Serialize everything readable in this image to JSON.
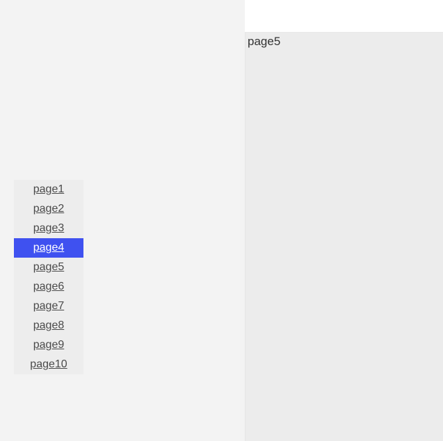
{
  "rightPanel": {
    "title": "page5"
  },
  "pageList": {
    "items": [
      {
        "label": "page1",
        "selected": false
      },
      {
        "label": "page2",
        "selected": false
      },
      {
        "label": "page3",
        "selected": false
      },
      {
        "label": "page4",
        "selected": true
      },
      {
        "label": "page5",
        "selected": false
      },
      {
        "label": "page6",
        "selected": false
      },
      {
        "label": "page7",
        "selected": false
      },
      {
        "label": "page8",
        "selected": false
      },
      {
        "label": "page9",
        "selected": false
      },
      {
        "label": "page10",
        "selected": false
      }
    ]
  }
}
